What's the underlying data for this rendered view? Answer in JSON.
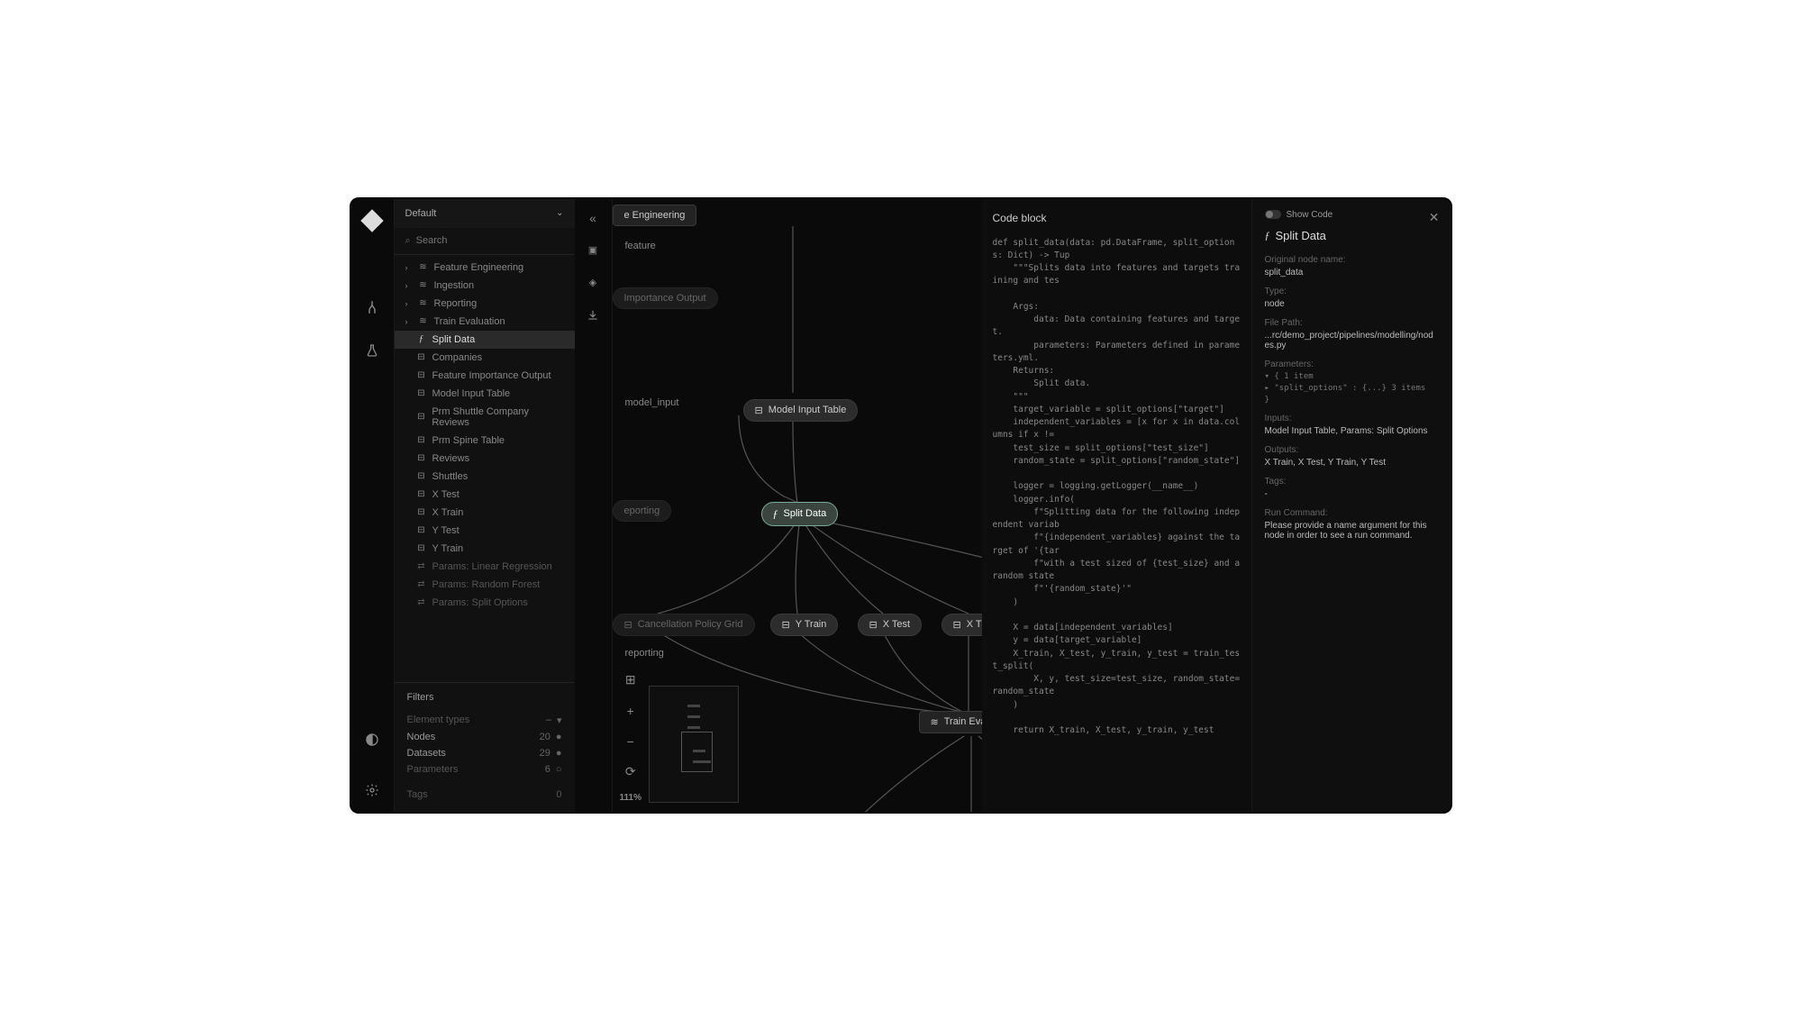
{
  "selector": {
    "label": "Default"
  },
  "search": {
    "placeholder": "Search"
  },
  "tree": {
    "groups": [
      {
        "label": "Feature Engineering",
        "icon": "layers"
      },
      {
        "label": "Ingestion",
        "icon": "layers"
      },
      {
        "label": "Reporting",
        "icon": "layers"
      },
      {
        "label": "Train Evaluation",
        "icon": "layers"
      }
    ],
    "children": [
      {
        "label": "Split Data",
        "icon": "fn",
        "selected": true
      },
      {
        "label": "Companies",
        "icon": "db"
      },
      {
        "label": "Feature Importance Output",
        "icon": "db"
      },
      {
        "label": "Model Input Table",
        "icon": "db"
      },
      {
        "label": "Prm Shuttle Company Reviews",
        "icon": "db"
      },
      {
        "label": "Prm Spine Table",
        "icon": "db"
      },
      {
        "label": "Reviews",
        "icon": "db"
      },
      {
        "label": "Shuttles",
        "icon": "db"
      },
      {
        "label": "X Test",
        "icon": "db"
      },
      {
        "label": "X Train",
        "icon": "db"
      },
      {
        "label": "Y Test",
        "icon": "db"
      },
      {
        "label": "Y Train",
        "icon": "db"
      },
      {
        "label": "Params: Linear Regression",
        "icon": "param",
        "dim": true
      },
      {
        "label": "Params: Random Forest",
        "icon": "param",
        "dim": true
      },
      {
        "label": "Params: Split Options",
        "icon": "param",
        "dim": true
      }
    ]
  },
  "filters": {
    "title": "Filters",
    "element_types": "Element types",
    "rows": [
      {
        "label": "Nodes",
        "count": "20"
      },
      {
        "label": "Datasets",
        "count": "29"
      },
      {
        "label": "Parameters",
        "count": "6",
        "dim": true
      }
    ],
    "tags": "Tags",
    "tags_count": "0"
  },
  "canvas": {
    "zoom": "111%",
    "nodes": {
      "eng_header": "e Engineering",
      "feature": "feature",
      "importance": "Importance Output",
      "model_input_label": "model_input",
      "model_input_table": "Model Input Table",
      "reporting_pill": "eporting",
      "split_data": "Split Data",
      "cancel_policy": "Cancellation Policy Grid",
      "y_train": "Y Train",
      "x_test": "X Test",
      "x_train": "X Trai",
      "reporting_label": "reporting",
      "train_eval": "Train Eval"
    }
  },
  "code": {
    "title": "Code block",
    "body": "def split_data(data: pd.DataFrame, split_options: Dict) -> Tup\n    \"\"\"Splits data into features and targets training and tes\n\n    Args:\n        data: Data containing features and target.\n        parameters: Parameters defined in parameters.yml.\n    Returns:\n        Split data.\n    \"\"\"\n    target_variable = split_options[\"target\"]\n    independent_variables = [x for x in data.columns if x !=\n    test_size = split_options[\"test_size\"]\n    random_state = split_options[\"random_state\"]\n\n    logger = logging.getLogger(__name__)\n    logger.info(\n        f\"Splitting data for the following independent variab\n        f\"{independent_variables} against the target of '{tar\n        f\"with a test sized of {test_size} and a random state\n        f\"'{random_state}'\"\n    )\n\n    X = data[independent_variables]\n    y = data[target_variable]\n    X_train, X_test, y_train, y_test = train_test_split(\n        X, y, test_size=test_size, random_state=random_state\n    )\n\n    return X_train, X_test, y_train, y_test"
  },
  "meta": {
    "show_code": "Show Code",
    "title": "Split Data",
    "fields": {
      "orig_name_lbl": "Original node name:",
      "orig_name": "split_data",
      "type_lbl": "Type:",
      "type": "node",
      "path_lbl": "File Path:",
      "path": "...rc/demo_project/pipelines/modelling/nodes.py",
      "params_lbl": "Parameters:",
      "params_line1": "▾ { 1 item",
      "params_line2": "  ▸ \"split_options\" : {...} 3 items",
      "params_line3": "}",
      "inputs_lbl": "Inputs:",
      "inputs": "Model Input Table,   Params: Split Options",
      "outputs_lbl": "Outputs:",
      "outputs": "X Train,   X Test,   Y Train,   Y Test",
      "tags_lbl": "Tags:",
      "tags": "-",
      "run_lbl": "Run Command:",
      "run": "Please provide a name argument for this node in order to see a run command."
    }
  }
}
